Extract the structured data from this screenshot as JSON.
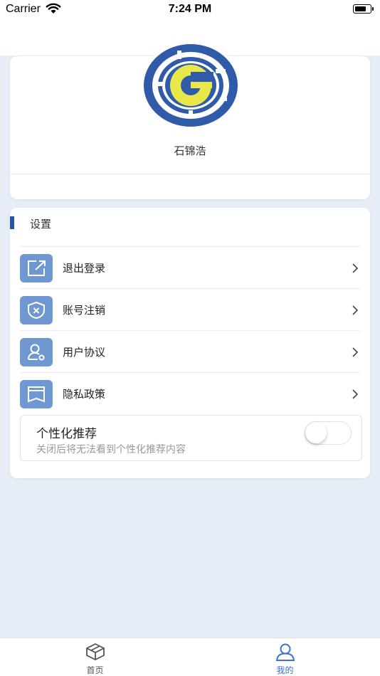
{
  "status_bar": {
    "carrier": "Carrier",
    "time": "7:24 PM"
  },
  "profile": {
    "user_name": "石锦浩",
    "logo_icon": "g-logo-icon"
  },
  "settings": {
    "section_title": "设置",
    "items": [
      {
        "label": "退出登录",
        "icon": "logout-icon"
      },
      {
        "label": "账号注销",
        "icon": "shield-x-icon"
      },
      {
        "label": "用户协议",
        "icon": "user-settings-icon"
      },
      {
        "label": "隐私政策",
        "icon": "book-icon"
      }
    ],
    "personalized": {
      "title": "个性化推荐",
      "description": "关闭后将无法看到个性化推荐内容",
      "enabled": false
    }
  },
  "tab_bar": {
    "tabs": [
      {
        "label": "首页",
        "icon": "home-cube-icon",
        "active": false
      },
      {
        "label": "我的",
        "icon": "user-icon",
        "active": true
      }
    ],
    "active_color": "#3a6fd6",
    "inactive_color": "#555555"
  },
  "colors": {
    "accent": "#2754a6",
    "icon_bg": "#6f98d3",
    "page_bg": "#e6edf6"
  }
}
